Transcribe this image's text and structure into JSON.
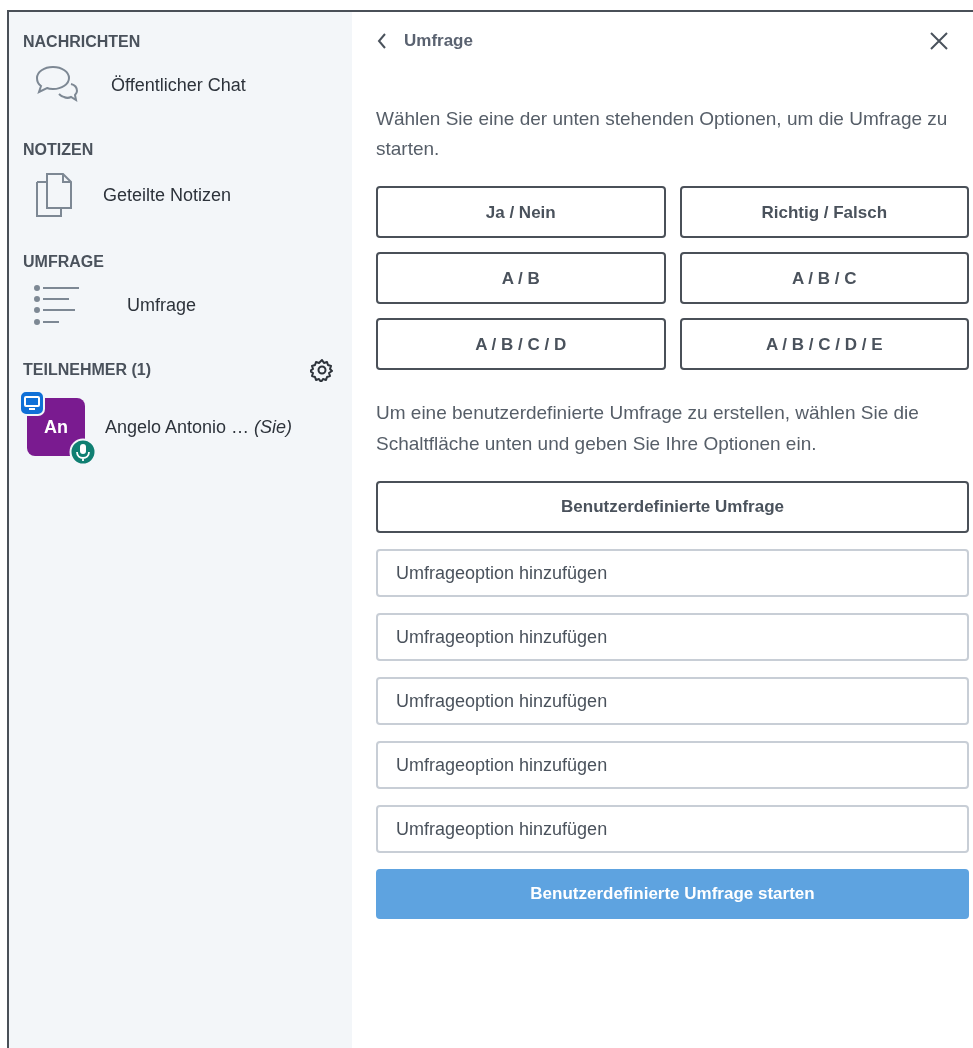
{
  "sidebar": {
    "sections": [
      {
        "title": "NACHRICHTEN",
        "items": [
          {
            "kind": "chat",
            "label": "Öffentlicher Chat"
          }
        ]
      },
      {
        "title": "NOTIZEN",
        "items": [
          {
            "kind": "notes",
            "label": "Geteilte Notizen"
          }
        ]
      },
      {
        "title": "UMFRAGE",
        "items": [
          {
            "kind": "poll",
            "label": "Umfrage"
          }
        ]
      }
    ],
    "participants": {
      "title": "TEILNEHMER (1)",
      "users": [
        {
          "initials": "An",
          "name": "Angelo Antonio …",
          "suffix": "(Sie)"
        }
      ]
    }
  },
  "panel": {
    "title": "Umfrage",
    "intro": "Wählen Sie eine der unten stehenden Optionen, um die Umfrage zu starten.",
    "presets": [
      "Ja / Nein",
      "Richtig / Falsch",
      "A / B",
      "A / B / C",
      "A / B / C / D",
      "A / B / C / D / E"
    ],
    "custom_intro": "Um eine benutzerdefinierte Umfrage zu erstellen, wählen Sie die Schaltfläche unten und geben Sie Ihre Optionen ein.",
    "custom_button": "Benutzerdefinierte Umfrage",
    "options": [
      {
        "placeholder": "Umfrageoption hinzufügen"
      },
      {
        "placeholder": "Umfrageoption hinzufügen"
      },
      {
        "placeholder": "Umfrageoption hinzufügen"
      },
      {
        "placeholder": "Umfrageoption hinzufügen"
      },
      {
        "placeholder": "Umfrageoption hinzufügen"
      }
    ],
    "start_button": {
      "label": "Benutzerdefinierte Umfrage starten",
      "disabled": true
    }
  }
}
